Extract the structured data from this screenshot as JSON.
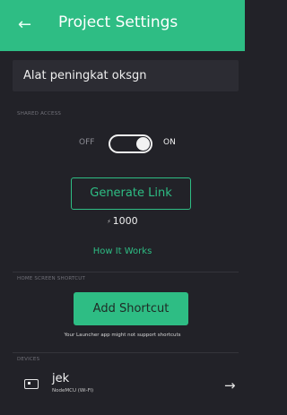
{
  "header": {
    "back_icon": "arrow-left-icon",
    "title": "Project Settings",
    "background_color": "#2ebd84"
  },
  "project": {
    "name_value": "Alat peningkat oksgn"
  },
  "shared_access": {
    "section_label": "SHARED ACCESS",
    "off_label": "OFF",
    "on_label": "ON",
    "toggle_state": "on",
    "generate_link_label": "Generate Link",
    "energy_symbol": "⚡",
    "energy_value": "1000",
    "how_it_works_label": "How It Works"
  },
  "shortcut": {
    "section_label": "HOME SCREEN SHORTCUT",
    "add_label": "Add Shortcut",
    "hint": "Your Launcher app might not support shortcuts"
  },
  "devices": {
    "section_label": "DEVICES",
    "items": [
      {
        "name": "jek",
        "type": "NodeMCU (Wi-Fi)",
        "icon": "device-icon",
        "arrow_icon": "arrow-right-icon"
      }
    ]
  },
  "colors": {
    "accent": "#2ebd84",
    "background": "#222228",
    "field": "#2c2c33"
  }
}
